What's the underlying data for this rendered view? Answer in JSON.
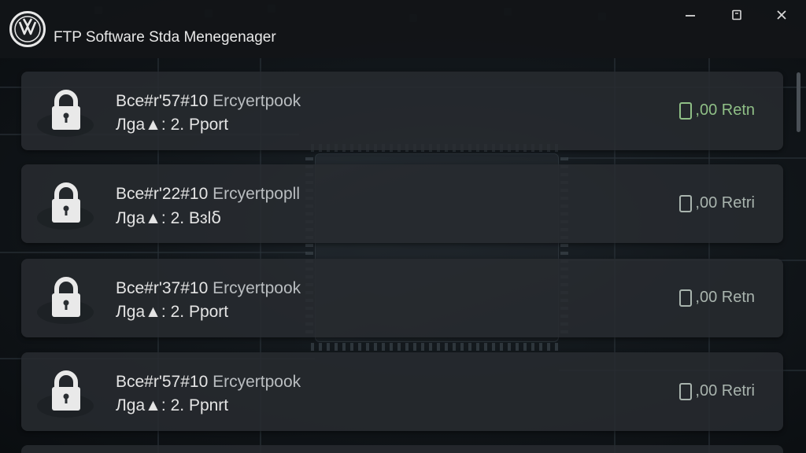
{
  "titlebar": {
    "app_title": "FTP Software Stda Menegenager",
    "logo_icon": "vw-logo-icon",
    "controls": {
      "minimize": "—",
      "maximize": "▢",
      "close": "✕"
    }
  },
  "colors": {
    "status_green": "#8fbf86",
    "status_gray": "#a9b4ae",
    "card_bg": "#2a2e32"
  },
  "entries": [
    {
      "code": "Bce#r'57#10",
      "label": "Ercyertpook",
      "sub": "Лga▲: 2. Pport",
      "status": ",00 Retn",
      "status_color": "#8fbf86",
      "icon": "lock-icon"
    },
    {
      "code": "Bce#r'22#10",
      "label": "Ercyertpopll",
      "sub": "Лga▲: 2. Bɜlẟ",
      "status": ",00 Retri",
      "status_color": "#a9b4ae",
      "icon": "lock-icon"
    },
    {
      "code": "Bce#r'37#10",
      "label": "Ercyertpook",
      "sub": "Лga▲: 2. Pport",
      "status": ",00 Retn",
      "status_color": "#a9b4ae",
      "icon": "lock-icon"
    },
    {
      "code": "Bce#r'57#10",
      "label": "Ercyertpook",
      "sub": "Лga▲: 2. Ppnrt",
      "status": ",00 Retri",
      "status_color": "#a9b4ae",
      "icon": "lock-icon"
    }
  ]
}
